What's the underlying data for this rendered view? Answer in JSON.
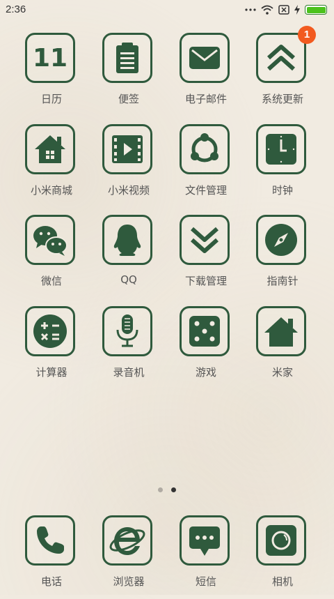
{
  "status_bar": {
    "time": "2:36",
    "icons": [
      "more-dots-icon",
      "wifi-icon",
      "no-sim-icon",
      "charging-bolt-icon",
      "battery-icon"
    ],
    "battery_color": "#4cc21c"
  },
  "apps": [
    {
      "label": "日历",
      "icon": "calendar-icon",
      "icon_text": "11"
    },
    {
      "label": "便签",
      "icon": "notes-icon"
    },
    {
      "label": "电子邮件",
      "icon": "mail-icon"
    },
    {
      "label": "系统更新",
      "icon": "update-icon",
      "badge": "1"
    },
    {
      "label": "小米商城",
      "icon": "store-icon"
    },
    {
      "label": "小米视频",
      "icon": "video-icon"
    },
    {
      "label": "文件管理",
      "icon": "file-manager-icon"
    },
    {
      "label": "时钟",
      "icon": "clock-icon"
    },
    {
      "label": "微信",
      "icon": "wechat-icon"
    },
    {
      "label": "QQ",
      "icon": "qq-icon"
    },
    {
      "label": "下载管理",
      "icon": "download-icon"
    },
    {
      "label": "指南针",
      "icon": "compass-icon"
    },
    {
      "label": "计算器",
      "icon": "calculator-icon"
    },
    {
      "label": "录音机",
      "icon": "recorder-icon"
    },
    {
      "label": "游戏",
      "icon": "game-dice-icon"
    },
    {
      "label": "米家",
      "icon": "mijia-home-icon"
    }
  ],
  "page_indicator": {
    "count": 2,
    "active_index": 1,
    "active_color": "#333333",
    "inactive_color": "#b0aba3"
  },
  "dock": [
    {
      "label": "电话",
      "icon": "phone-icon"
    },
    {
      "label": "浏览器",
      "icon": "browser-icon"
    },
    {
      "label": "短信",
      "icon": "sms-icon"
    },
    {
      "label": "相机",
      "icon": "camera-icon"
    }
  ],
  "theme": {
    "icon_color": "#2f5a3d",
    "badge_color": "#f25a1f"
  }
}
